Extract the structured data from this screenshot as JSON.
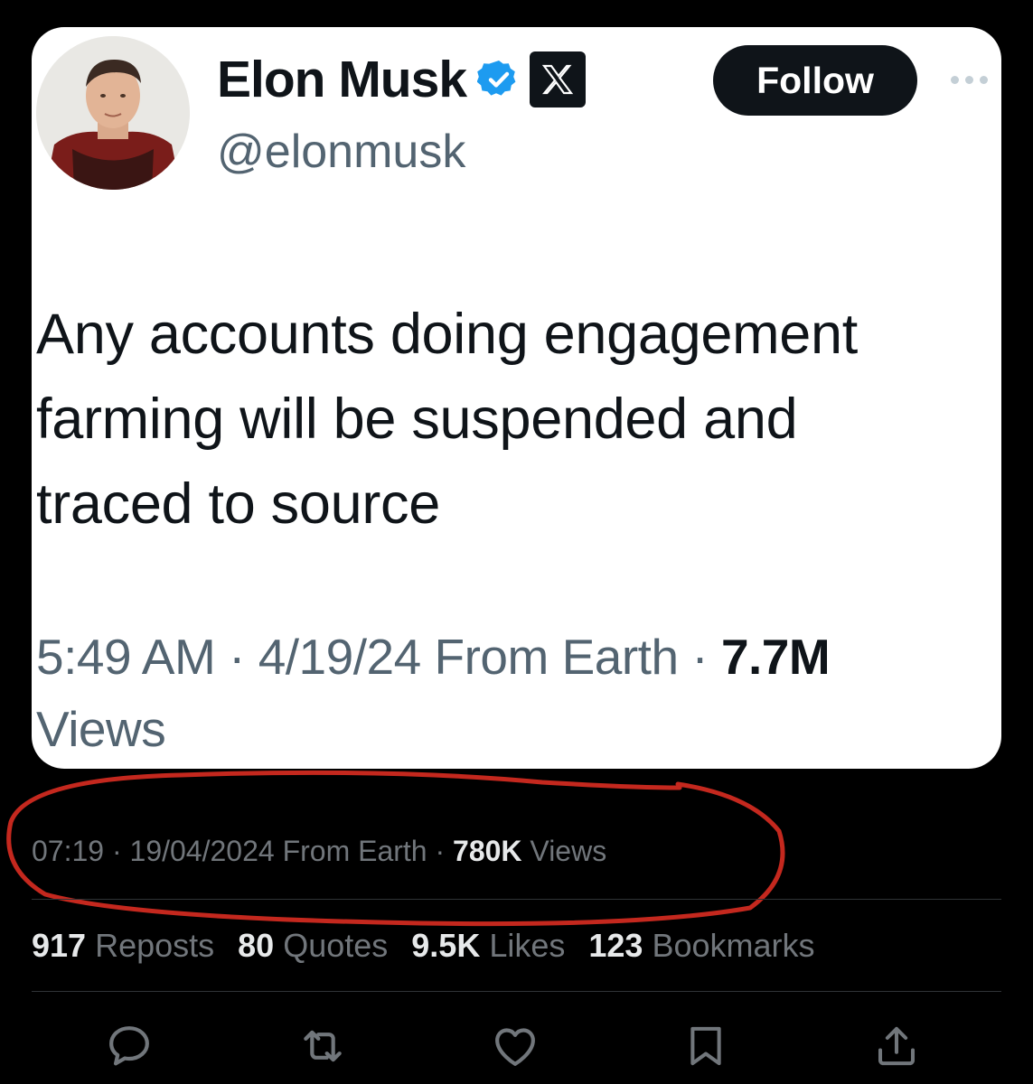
{
  "card": {
    "display_name": "Elon Musk",
    "handle": "@elonmusk",
    "follow_label": "Follow",
    "text_lines": [
      "Any accounts doing engagement",
      "farming will be suspended and",
      "traced to source"
    ],
    "time": "5:49 AM",
    "date": "4/19/24",
    "source": "From Earth",
    "views_count": "7.7M",
    "views_label": "Views",
    "separator": "·"
  },
  "outer": {
    "time": "07:19",
    "date": "19/04/2024",
    "source": "From Earth",
    "views_count": "780K",
    "views_label": "Views",
    "separator": "·"
  },
  "stats": [
    {
      "value": "917",
      "label": "Reposts"
    },
    {
      "value": "80",
      "label": "Quotes"
    },
    {
      "value": "9.5K",
      "label": "Likes"
    },
    {
      "value": "123",
      "label": "Bookmarks"
    }
  ],
  "actions": [
    "reply-icon",
    "repost-icon",
    "like-icon",
    "bookmark-icon",
    "share-icon"
  ],
  "colors": {
    "background": "#000000",
    "card_background": "#ffffff",
    "verified_blue": "#1d9bf0",
    "annotation_red": "#c4281e",
    "muted_text": "#71767b",
    "primary_text": "#e7e9ea"
  }
}
